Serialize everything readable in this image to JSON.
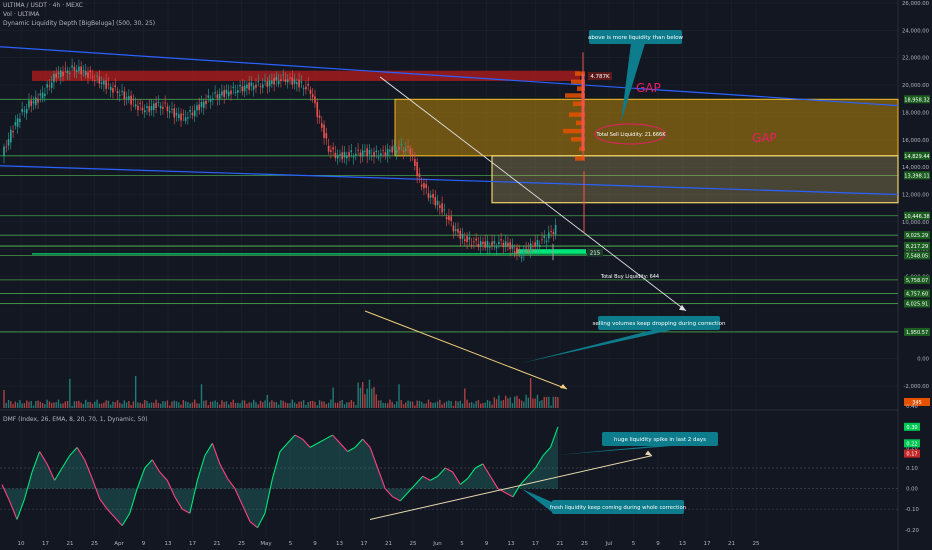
{
  "header": {
    "line1": "ULTIMA / USDT · 4h · MEXC",
    "line2": "Vol · ULTIMA",
    "line3": "Dynamic Liquidity Depth [BigBeluga] (500, 30, 25)"
  },
  "dmf_header": "DMF (Index, 26, EMA, 8, 20, 70, 1, Dynamic, 50)",
  "colors": {
    "background": "#131722",
    "grid": "#1e222d",
    "up": "#26a69a",
    "down": "#ef5350",
    "level_line": "#4caf50",
    "trendline": "#2962ff",
    "gap_fill": "#b8860b",
    "sell_liquidity": "#b71c1c",
    "buy_liquidity": "#00e676",
    "callout": "#0d7c8c",
    "arrow": "#e0e0e0",
    "annotation_yellow": "#f0d07a",
    "gap_text": "#e91e63"
  },
  "chart_data": [
    {
      "type": "candlestick",
      "title": "ULTIMA / USDT · 4h · MEXC",
      "ylim": [
        0,
        26000
      ],
      "y_ticks": [
        "26,000.00",
        "24,000.00",
        "22,000.00",
        "20,000.00",
        "18,000.00",
        "16,000.00",
        "14,000.00",
        "12,000.00",
        "10,000.00",
        "8,000.00",
        "6,000.00",
        "4,000.00",
        "2,000.00",
        "0.00",
        "-2,000.00"
      ],
      "x_ticks": [
        "10",
        "17",
        "21",
        "25",
        "Apr",
        "9",
        "13",
        "17",
        "21",
        "25",
        "May",
        "5",
        "9",
        "13",
        "17",
        "21",
        "25",
        "Jun",
        "5",
        "9",
        "13",
        "17",
        "21",
        "25",
        "Jul",
        "5",
        "9",
        "13",
        "17",
        "21",
        "25"
      ],
      "close_path": [
        [
          0,
          14800
        ],
        [
          4,
          16500
        ],
        [
          8,
          17800
        ],
        [
          12,
          18600
        ],
        [
          16,
          19000
        ],
        [
          20,
          19800
        ],
        [
          24,
          20800
        ],
        [
          28,
          21000
        ],
        [
          32,
          21200
        ],
        [
          36,
          21000
        ],
        [
          40,
          20600
        ],
        [
          44,
          20200
        ],
        [
          48,
          19800
        ],
        [
          52,
          19400
        ],
        [
          56,
          19000
        ],
        [
          60,
          18400
        ],
        [
          64,
          18200
        ],
        [
          68,
          18600
        ],
        [
          72,
          18400
        ],
        [
          76,
          17900
        ],
        [
          80,
          17600
        ],
        [
          84,
          18000
        ],
        [
          88,
          18600
        ],
        [
          92,
          19100
        ],
        [
          96,
          19300
        ],
        [
          100,
          19500
        ],
        [
          104,
          19700
        ],
        [
          108,
          19900
        ],
        [
          112,
          20000
        ],
        [
          116,
          20100
        ],
        [
          120,
          20300
        ],
        [
          124,
          20500
        ],
        [
          128,
          20300
        ],
        [
          132,
          20000
        ],
        [
          136,
          19600
        ],
        [
          140,
          17400
        ],
        [
          144,
          15300
        ],
        [
          148,
          14800
        ],
        [
          152,
          14900
        ],
        [
          156,
          15000
        ],
        [
          160,
          15100
        ],
        [
          164,
          14900
        ],
        [
          168,
          15000
        ],
        [
          172,
          15300
        ],
        [
          176,
          15400
        ],
        [
          180,
          15200
        ],
        [
          184,
          13000
        ],
        [
          188,
          12000
        ],
        [
          192,
          11300
        ],
        [
          196,
          10400
        ],
        [
          200,
          9300
        ],
        [
          204,
          8700
        ],
        [
          208,
          8500
        ],
        [
          212,
          8350
        ],
        [
          216,
          8300
        ],
        [
          220,
          8500
        ],
        [
          224,
          8200
        ],
        [
          228,
          7600
        ],
        [
          232,
          8100
        ],
        [
          236,
          8400
        ],
        [
          240,
          8900
        ],
        [
          244,
          9500
        ]
      ],
      "levels": [
        "18,958.32",
        "14,829.44",
        "13,398.11",
        "10,446.38",
        "9,025.29",
        "8,243.56",
        "8,217.29",
        "7,548.05",
        "5,758.07",
        "4,757.60",
        "4,025.91",
        "1,950.57"
      ],
      "volume_label": "345",
      "annotations": {
        "sell_liquidity_value": "4.787K",
        "buy_liquidity_value": "215",
        "total_sell_liquidity": "Total Sell Liquidity: 21.666K",
        "total_buy_liquidity": "Total Buy Liquidity: 644",
        "gap_label_1": "GAP",
        "gap_label_2": "GAP",
        "callout_top": "above is more liquidity than below",
        "callout_volume": "selling volumes keep dropping during correction"
      }
    },
    {
      "type": "line",
      "title": "DMF (Index, 26, EMA, 8, 20, 70, 1, Dynamic, 50)",
      "ylim": [
        -0.24,
        0.44
      ],
      "y_ticks": [
        "0.40",
        "0.20",
        "0.10",
        "0.00",
        "-0.10",
        "-0.20"
      ],
      "value_labels": [
        "0.30",
        "0.22",
        "0.17"
      ],
      "series": [
        {
          "values": [
            0.02,
            -0.06,
            -0.15,
            -0.05,
            0.08,
            0.18,
            0.12,
            0.04,
            0.1,
            0.16,
            0.2,
            0.14,
            0.05,
            -0.05,
            -0.1,
            -0.14,
            -0.18,
            -0.12,
            0.0,
            0.1,
            0.14,
            0.08,
            0.04,
            -0.04,
            -0.1,
            -0.12,
            0.04,
            0.16,
            0.22,
            0.12,
            0.05,
            0.0,
            -0.08,
            -0.16,
            -0.19,
            -0.12,
            0.05,
            0.18,
            0.22,
            0.26,
            0.24,
            0.2,
            0.22,
            0.24,
            0.26,
            0.22,
            0.18,
            0.2,
            0.24,
            0.2,
            0.1,
            0.0,
            -0.04,
            -0.06,
            -0.02,
            0.02,
            0.06,
            0.04,
            0.06,
            0.1,
            0.08,
            0.02,
            0.05,
            0.1,
            0.12,
            0.06,
            0.0,
            -0.02,
            -0.04,
            0.02,
            0.06,
            0.1,
            0.16,
            0.2,
            0.3
          ]
        }
      ],
      "annotations": {
        "callout_spike": "huge liquidity spike in last 2 days",
        "callout_fresh": "fresh liquidity keep coming during whole correction"
      }
    }
  ]
}
